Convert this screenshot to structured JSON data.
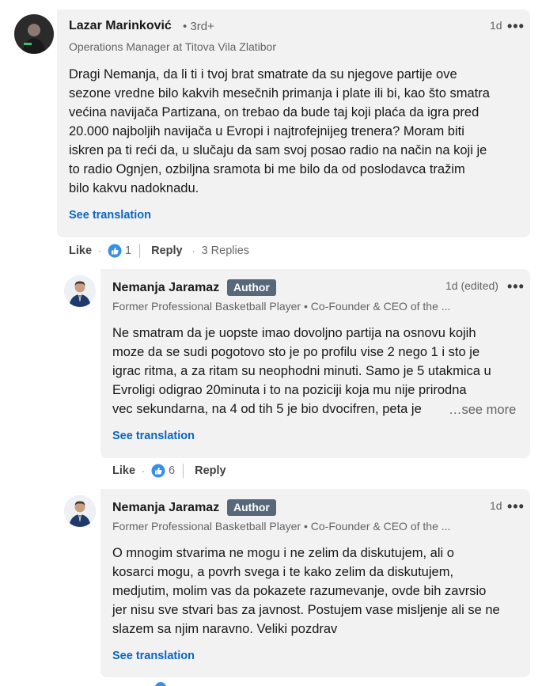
{
  "comments": [
    {
      "author": "Lazar Marinković",
      "degree": "• 3rd+",
      "headline": "Operations Manager at Titova Vila Zlatibor",
      "time": "1d",
      "text_lines": [
        "Dragi Nemanja, da li ti i tvoj brat smatrate da su njegove partije ove",
        "sezone vredne bilo kakvih mesečnih primanja i plate ili bi, kao što smatra",
        "većina navijača Partizana, on trebao da bude taj koji plaća da igra pred",
        "20.000 najboljih navijača u Evropi i najtrofejnijeg trenera? Moram biti",
        "iskren pa ti reći da, u slučaju da sam svoj posao radio na način na koji je",
        "to radio Ognjen, ozbiljna sramota bi me bilo da od poslodavca tražim",
        "bilo kakvu nadoknadu."
      ],
      "see_translation": "See translation",
      "like_label": "Like",
      "like_count": "1",
      "reply_label": "Reply",
      "replies_label": "3 Replies"
    },
    {
      "author": "Nemanja Jaramaz",
      "badge": "Author",
      "headline": "Former Professional Basketball Player • Co-Founder & CEO of the ...",
      "time": "1d (edited)",
      "text_lines": [
        "Ne smatram da je uopste imao dovoljno partija na osnovu kojih",
        "moze da se sudi pogotovo sto je po profilu vise 2 nego 1 i sto je",
        "igrac ritma, a za ritam su neophodni minuti. Samo je 5 utakmica u",
        "Evroligi odigrao 20minuta i to na poziciji koja mu nije prirodna",
        "vec sekundarna, na 4 od tih 5 je bio dvocifren, peta je"
      ],
      "see_more": "…see more",
      "see_translation": "See translation",
      "like_label": "Like",
      "like_count": "6",
      "reply_label": "Reply"
    },
    {
      "author": "Nemanja Jaramaz",
      "badge": "Author",
      "headline": "Former Professional Basketball Player • Co-Founder & CEO of the ...",
      "time": "1d",
      "text_lines": [
        "O mnogim stvarima ne mogu i ne zelim da diskutujem, ali o",
        "kosarci mogu, a povrh svega i te kako zelim da diskutujem,",
        "medjutim, molim vas da pokazete razumevanje, ovde bih zavrsio",
        "jer nisu sve stvari bas za javnost. Postujem vase misljenje ali se ne",
        "slazem sa njim naravno. Veliki pozdrav"
      ],
      "see_translation": "See translation"
    }
  ],
  "icons": {
    "overflow": "three-dots-icon",
    "like": "thumbs-up-reaction-icon"
  },
  "colors": {
    "link": "#0a66c2",
    "bubble": "#f2f2f2",
    "badge": "#56687a",
    "like_blue": "#378fe9"
  }
}
